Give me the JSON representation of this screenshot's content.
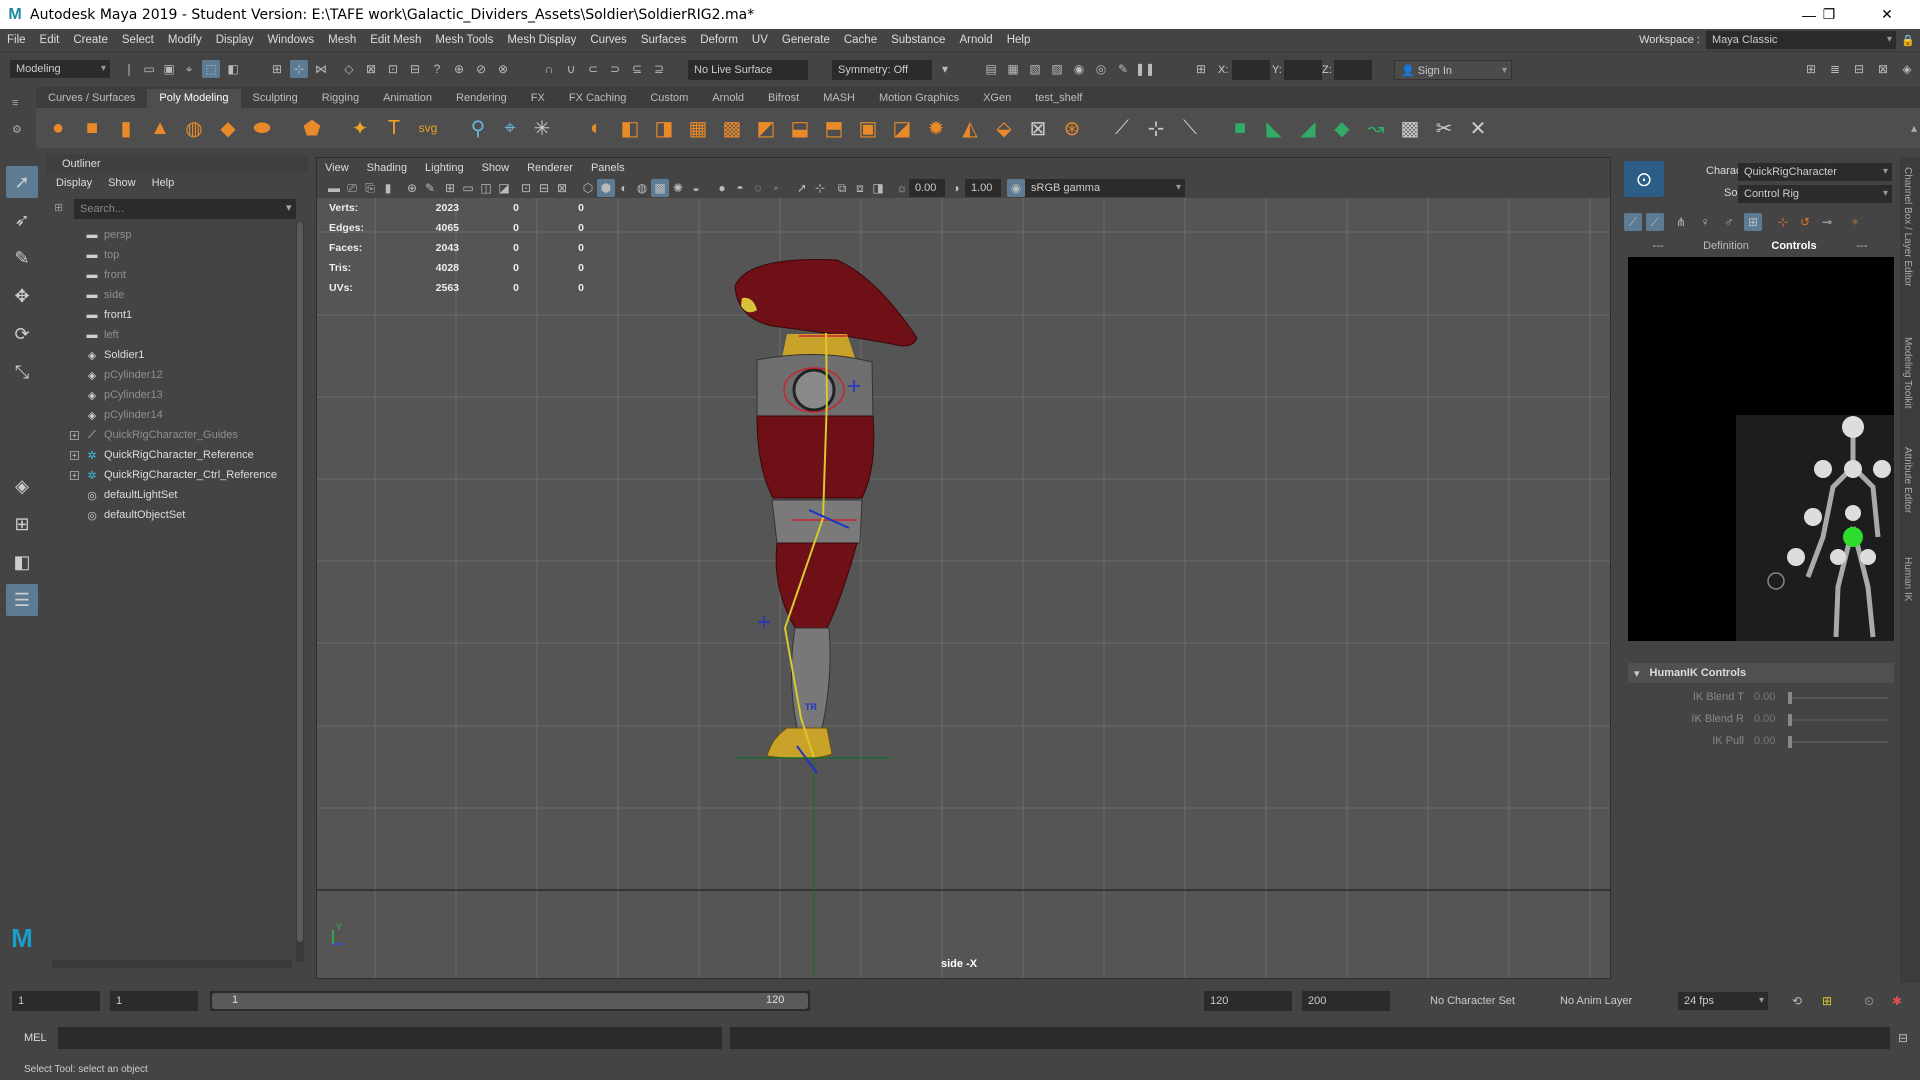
{
  "window": {
    "title": "Autodesk Maya 2019 - Student Version: E:\\TAFE work\\Galactic_Dividers_Assets\\Soldier\\SoldierRIG2.ma*",
    "logo_letter": "M",
    "minimize": "—",
    "restore": "❐",
    "close": "✕"
  },
  "menubar": {
    "items": [
      "File",
      "Edit",
      "Create",
      "Select",
      "Modify",
      "Display",
      "Windows",
      "Mesh",
      "Edit Mesh",
      "Mesh Tools",
      "Mesh Display",
      "Curves",
      "Surfaces",
      "Deform",
      "UV",
      "Generate",
      "Cache",
      "Substance",
      "Arnold",
      "Help"
    ],
    "workspace_label": "Workspace :",
    "workspace_value": "Maya Classic"
  },
  "statusline": {
    "mode": "Modeling",
    "live_surface": "No Live Surface",
    "symmetry": "Symmetry: Off",
    "x_label": "X:",
    "y_label": "Y:",
    "z_label": "Z:",
    "sign_in": "Sign In"
  },
  "shelf": {
    "tabs": [
      "Curves / Surfaces",
      "Poly Modeling",
      "Sculpting",
      "Rigging",
      "Animation",
      "Rendering",
      "FX",
      "FX Caching",
      "Custom",
      "Arnold",
      "Bifrost",
      "MASH",
      "Motion Graphics",
      "XGen",
      "test_shelf"
    ],
    "active_tab": "Poly Modeling"
  },
  "outliner": {
    "title": "Outliner",
    "menu": [
      "Display",
      "Show",
      "Help"
    ],
    "search_placeholder": "Search...",
    "items": [
      {
        "label": "persp",
        "icon": "camera-icon",
        "dim": true,
        "expandable": false
      },
      {
        "label": "top",
        "icon": "camera-icon",
        "dim": true,
        "expandable": false
      },
      {
        "label": "front",
        "icon": "camera-icon",
        "dim": true,
        "expandable": false
      },
      {
        "label": "side",
        "icon": "camera-icon",
        "dim": true,
        "expandable": false
      },
      {
        "label": "front1",
        "icon": "camera-icon",
        "dim": false,
        "expandable": false
      },
      {
        "label": "left",
        "icon": "camera-icon",
        "dim": true,
        "expandable": false
      },
      {
        "label": "Soldier1",
        "icon": "mesh-icon",
        "dim": false,
        "expandable": false
      },
      {
        "label": "pCylinder12",
        "icon": "mesh-icon",
        "dim": true,
        "expandable": false
      },
      {
        "label": "pCylinder13",
        "icon": "mesh-icon",
        "dim": true,
        "expandable": false
      },
      {
        "label": "pCylinder14",
        "icon": "mesh-icon",
        "dim": true,
        "expandable": false
      },
      {
        "label": "QuickRigCharacter_Guides",
        "icon": "guide-icon",
        "dim": true,
        "expandable": true
      },
      {
        "label": "QuickRigCharacter_Reference",
        "icon": "joint-icon",
        "dim": false,
        "expandable": true
      },
      {
        "label": "QuickRigCharacter_Ctrl_Reference",
        "icon": "joint-icon",
        "dim": false,
        "expandable": true
      },
      {
        "label": "defaultLightSet",
        "icon": "set-icon",
        "dim": false,
        "expandable": false
      },
      {
        "label": "defaultObjectSet",
        "icon": "set-icon",
        "dim": false,
        "expandable": false
      }
    ]
  },
  "viewport": {
    "menu": [
      "View",
      "Shading",
      "Lighting",
      "Show",
      "Renderer",
      "Panels"
    ],
    "exposure": "0.00",
    "gamma": "1.00",
    "color_space": "sRGB gamma",
    "camera_label": "side -X",
    "hud": [
      {
        "label": "Verts:",
        "v1": "2023",
        "v2": "0",
        "v3": "0"
      },
      {
        "label": "Edges:",
        "v1": "4065",
        "v2": "0",
        "v3": "0"
      },
      {
        "label": "Faces:",
        "v1": "2043",
        "v2": "0",
        "v3": "0"
      },
      {
        "label": "Tris:",
        "v1": "4028",
        "v2": "0",
        "v3": "0"
      },
      {
        "label": "UVs:",
        "v1": "2563",
        "v2": "0",
        "v3": "0"
      }
    ],
    "axis_y": "Y",
    "colors": {
      "body": "#6e1016",
      "armor": "#707070",
      "gold": "#c9a22a",
      "joint": "#d8c92c",
      "ctrl": "#cc2230"
    }
  },
  "humanik": {
    "character_label": "Character:",
    "character_value": "QuickRigCharacter",
    "source_label": "Source:",
    "source_value": "Control Rig",
    "tabs": [
      "---",
      "Definition",
      "Controls",
      "---"
    ],
    "active_tab": "Controls",
    "controls_header": "HumanIK Controls",
    "sliders": [
      {
        "label": "IK Blend T",
        "value": "0.00"
      },
      {
        "label": "IK Blend R",
        "value": "0.00"
      },
      {
        "label": "IK Pull",
        "value": "0.00"
      }
    ]
  },
  "side_tabs": [
    "Channel Box / Layer Editor",
    "Modeling Toolkit",
    "Attribute Editor",
    "Human IK"
  ],
  "timeline": {
    "start": "1",
    "current": "1",
    "range_start": "1",
    "range_end": "120",
    "end": "120",
    "anim_end": "200",
    "character_set": "No Character Set",
    "anim_layer": "No Anim Layer",
    "fps": "24 fps"
  },
  "command": {
    "lang": "MEL",
    "help": "Select Tool: select an object"
  }
}
